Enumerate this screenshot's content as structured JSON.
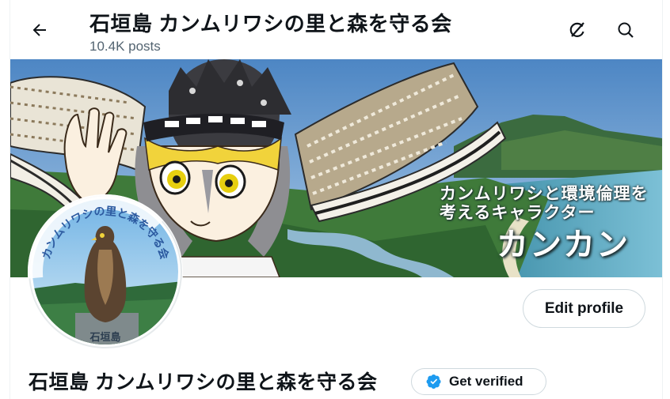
{
  "header": {
    "title": "石垣島 カンムリワシの里と森を守る会",
    "posts_count": "10.4K posts"
  },
  "banner": {
    "line1": "カンムリワシと環境倫理を",
    "line2": "考えるキャラクター",
    "character_name": "カンカン"
  },
  "avatar": {
    "ring_text": "カンムリワシの里と森を守る会",
    "caption": "石垣島"
  },
  "profile": {
    "display_name": "石垣島 カンムリワシの里と森を守る会",
    "edit_label": "Edit profile",
    "verify_label": "Get verified"
  },
  "icons": {
    "back": "arrow-left-icon",
    "grok": "grok-icon",
    "search": "search-icon",
    "verified": "verified-badge-icon"
  },
  "colors": {
    "verified_blue": "#1d9bf0",
    "text": "#0f1419",
    "secondary": "#536471",
    "border": "#cfd9de"
  }
}
